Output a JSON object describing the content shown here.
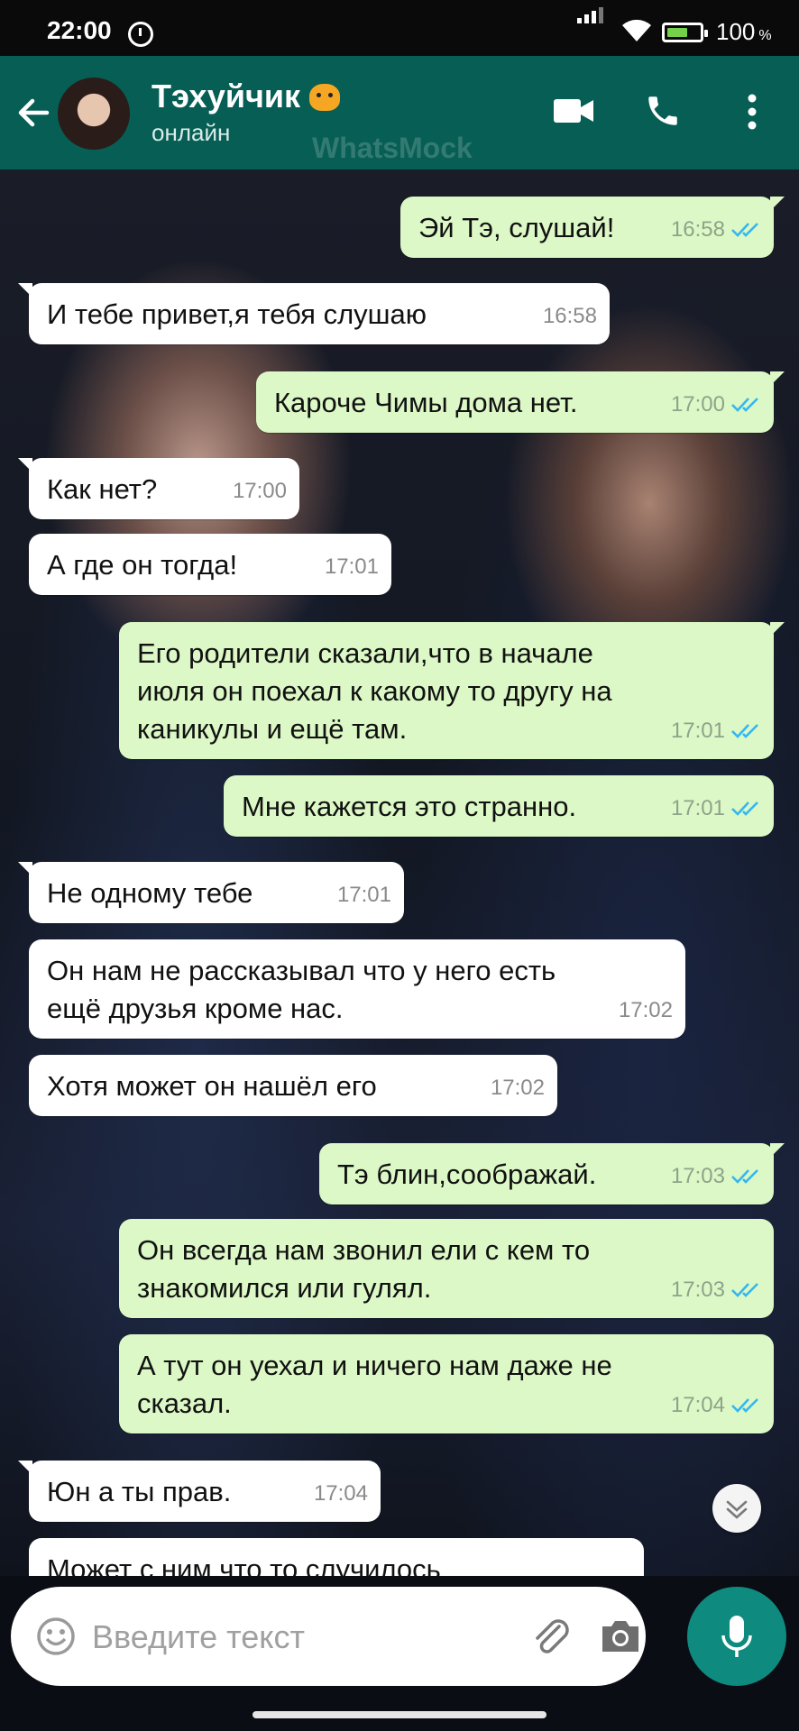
{
  "status_bar": {
    "time": "22:00",
    "battery_percent": "100",
    "battery_unit": "%"
  },
  "header": {
    "contact_name": "Тэхуйчик",
    "contact_status": "онлайн",
    "watermark": "WhatsMock"
  },
  "colors": {
    "header": "#075e54",
    "outgoing_bubble": "#dcf8c6",
    "incoming_bubble": "#ffffff",
    "read_tick": "#34b7f1",
    "mic_button": "#0f8a7e"
  },
  "messages": [
    {
      "dir": "out",
      "text": "Эй Тэ, слушай!",
      "time": "16:58"
    },
    {
      "dir": "in",
      "text": "И тебе привет,я тебя слушаю",
      "time": "16:58"
    },
    {
      "dir": "out",
      "text": "Кароче Чимы дома нет.",
      "time": "17:00"
    },
    {
      "dir": "in",
      "text": "Как нет?",
      "time": "17:00"
    },
    {
      "dir": "in",
      "text": "А где он тогда!",
      "time": "17:01"
    },
    {
      "dir": "out",
      "text": "Его родители сказали,что в начале\nиюля он поехал к какому то другу на\nканикулы и ещё там.",
      "time": "17:01"
    },
    {
      "dir": "out",
      "text": "Мне кажется это странно.",
      "time": "17:01"
    },
    {
      "dir": "in",
      "text": "Не одному тебе",
      "time": "17:01"
    },
    {
      "dir": "in",
      "text": "Он нам не рассказывал что у него есть\nещё друзья кроме нас.",
      "time": "17:02"
    },
    {
      "dir": "in",
      "text": "Хотя может он нашёл его",
      "time": "17:02"
    },
    {
      "dir": "out",
      "text": "Тэ блин,соображай.",
      "time": "17:03"
    },
    {
      "dir": "out",
      "text": "Он всегда нам звонил ели с кем то\nзнакомился или гулял.",
      "time": "17:03"
    },
    {
      "dir": "out",
      "text": "А тут он уехал и ничего нам даже не\nсказал.",
      "time": "17:04"
    },
    {
      "dir": "in",
      "text": "Юн а ты прав.",
      "time": "17:04"
    },
    {
      "dir": "in",
      "text": "Может с ним что то случилось",
      "time": ""
    }
  ],
  "composer": {
    "placeholder": "Введите текст"
  },
  "icons": [
    "back-arrow-icon",
    "tiger-emoji-icon",
    "video-call-icon",
    "phone-call-icon",
    "more-vert-icon",
    "emoji-icon",
    "attach-icon",
    "camera-icon",
    "mic-icon",
    "scroll-down-icon",
    "double-check-icon"
  ]
}
